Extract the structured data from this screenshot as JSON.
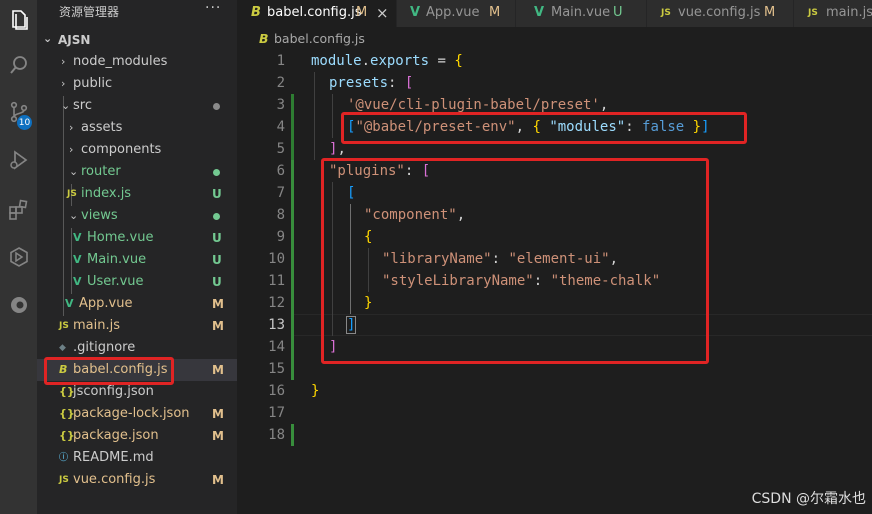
{
  "sidebar": {
    "header": "资源管理器",
    "more": "···",
    "root": "AJSN",
    "items": [
      {
        "label": "node_modules",
        "chev": "›",
        "icon": "",
        "status": "",
        "dot": ""
      },
      {
        "label": "public",
        "chev": "›",
        "icon": "",
        "status": "",
        "dot": ""
      },
      {
        "label": "src",
        "chev": "⌄",
        "icon": "",
        "status": "",
        "dot": "#8a8a8a"
      },
      {
        "label": "assets",
        "chev": "›",
        "icon": "",
        "status": "",
        "dot": ""
      },
      {
        "label": "components",
        "chev": "›",
        "icon": "",
        "status": "",
        "dot": ""
      },
      {
        "label": "router",
        "chev": "⌄",
        "icon": "",
        "status": "",
        "dot": "#73c991"
      },
      {
        "label": "index.js",
        "chev": "",
        "icon": "JS",
        "status": "U",
        "dot": ""
      },
      {
        "label": "views",
        "chev": "⌄",
        "icon": "",
        "status": "",
        "dot": "#73c991"
      },
      {
        "label": "Home.vue",
        "chev": "",
        "icon": "V",
        "status": "U",
        "dot": ""
      },
      {
        "label": "Main.vue",
        "chev": "",
        "icon": "V",
        "status": "U",
        "dot": ""
      },
      {
        "label": "User.vue",
        "chev": "",
        "icon": "V",
        "status": "U",
        "dot": ""
      },
      {
        "label": "App.vue",
        "chev": "",
        "icon": "V",
        "status": "M",
        "dot": ""
      },
      {
        "label": "main.js",
        "chev": "",
        "icon": "JS",
        "status": "M",
        "dot": ""
      },
      {
        "label": ".gitignore",
        "chev": "",
        "icon": "◆",
        "status": "",
        "dot": ""
      },
      {
        "label": "babel.config.js",
        "chev": "",
        "icon": "B",
        "status": "M",
        "dot": ""
      },
      {
        "label": "jsconfig.json",
        "chev": "",
        "icon": "{}",
        "status": "",
        "dot": ""
      },
      {
        "label": "package-lock.json",
        "chev": "",
        "icon": "{}",
        "status": "M",
        "dot": ""
      },
      {
        "label": "package.json",
        "chev": "",
        "icon": "{}",
        "status": "M",
        "dot": ""
      },
      {
        "label": "README.md",
        "chev": "",
        "icon": "ⓘ",
        "status": "",
        "dot": ""
      },
      {
        "label": "vue.config.js",
        "chev": "",
        "icon": "JS",
        "status": "M",
        "dot": ""
      }
    ]
  },
  "activity": {
    "scm_badge": "10"
  },
  "tabs": [
    {
      "label": "babel.config.js",
      "icon": "B",
      "status": "M",
      "close": "×"
    },
    {
      "label": "App.vue",
      "icon": "V",
      "status": "M",
      "close": ""
    },
    {
      "label": "Main.vue",
      "icon": "V",
      "status": "U",
      "close": ""
    },
    {
      "label": "vue.config.js",
      "icon": "JS",
      "status": "M",
      "close": ""
    },
    {
      "label": "main.js",
      "icon": "JS",
      "status": "",
      "close": ""
    }
  ],
  "breadcrumb": {
    "icon": "B",
    "file": "babel.config.js"
  },
  "code": {
    "line_numbers": [
      "1",
      "2",
      "3",
      "4",
      "5",
      "6",
      "7",
      "8",
      "9",
      "10",
      "11",
      "12",
      "13",
      "14",
      "15",
      "16",
      "17",
      "18"
    ],
    "current_line": "13",
    "l1": {
      "a": "module",
      "b": ".",
      "c": "exports",
      "d": " = ",
      "e": "{"
    },
    "l2": {
      "a": "presets",
      "b": ": ",
      "c": "["
    },
    "l3": {
      "a": "'@vue/cli-plugin-babel/preset'",
      "b": ","
    },
    "l4": {
      "a": "[",
      "b": "\"@babel/preset-env\"",
      "c": ", ",
      "d": "{",
      "e": " \"modules\"",
      "f": ": ",
      "g": "false",
      "h": " }",
      "i": "]"
    },
    "l5": {
      "a": "]",
      "b": ","
    },
    "l6": {
      "a": "\"plugins\"",
      "b": ": ",
      "c": "["
    },
    "l7": {
      "a": "["
    },
    "l8": {
      "a": "\"component\"",
      "b": ","
    },
    "l9": {
      "a": "{"
    },
    "l10": {
      "a": "\"libraryName\"",
      "b": ": ",
      "c": "\"element-ui\"",
      "d": ","
    },
    "l11": {
      "a": "\"styleLibraryName\"",
      "b": ": ",
      "c": "\"theme-chalk\""
    },
    "l12": {
      "a": "}"
    },
    "l13": {
      "a": "]"
    },
    "l14": {
      "a": "]"
    },
    "l16": {
      "a": "}"
    }
  },
  "watermark": "CSDN @尔霜水也",
  "colors": {
    "annotation_red": "#e02424",
    "modified": "#e2c08d",
    "untracked": "#73c991"
  }
}
